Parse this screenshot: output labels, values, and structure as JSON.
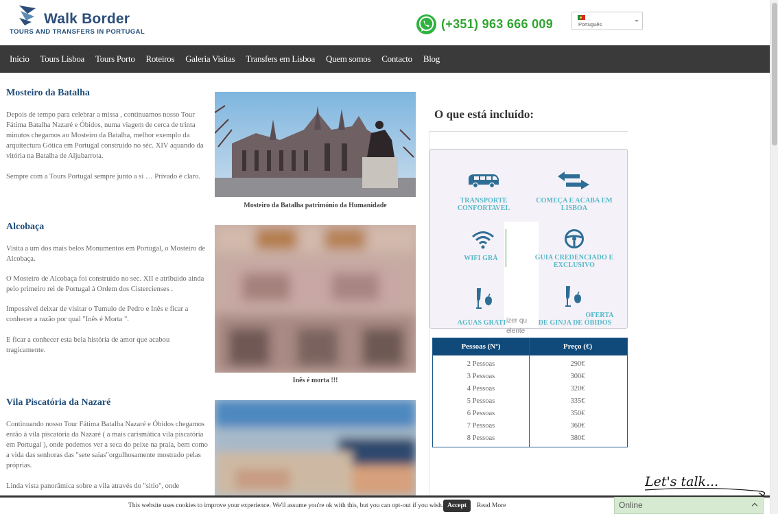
{
  "header": {
    "logo_title": "Walk Border",
    "logo_subtitle": "TOURS AND TRANSFERS IN PORTUGAL",
    "phone": "(+351) 963 666 009",
    "language": "Português",
    "brand_color": "#1f4d7a",
    "phone_color": "#2fa52f"
  },
  "nav": {
    "items": [
      "Início",
      "Tours Lisboa",
      "Tours Porto",
      "Roteiros",
      "Galeria Visitas",
      "Transfers em Lisboa",
      "Quem somos",
      "Contacto",
      "Blog"
    ]
  },
  "sections": [
    {
      "title": "Mosteiro da Batalha",
      "paragraphs": [
        "Depois de tempo para celebrar a missa , continuamos nosso Tour Fátima Batalha Nazaré e Óbidos, numa viagem de cerca de trinta minutos chegamos ao Mosteiro da Batalha, melhor exemplo da arquitectura Gótica em Portugal construido no séc. XIV aquando da vitória na Batalha de Aljubarrota.",
        "Sempre com a Tours Portugal sempre junto a si … Privado é claro."
      ],
      "caption": "Mosteiro da Batalha património da Humanidade"
    },
    {
      "title": "Alcobaça",
      "paragraphs": [
        "Visita a um dos mais belos Monumentos em Portugal, o Mosteiro de Alcobaça.",
        "O Mosteiro de Alcobaça foi construido no sec. XII e atribuido ainda pelo primeiro rei de Portugal à Ordem dos Cistercienses .",
        "Impossível deixar de visitar o Tumulo de Pedro e Inês e ficar a conhecer a razão por qual \"Inês é Morta \".",
        "E ficar a conhecer esta bela história de amor que acabou tragicamente."
      ],
      "caption": "Inês é morta !!!"
    },
    {
      "title": "Vila Piscatória da Nazaré",
      "paragraphs": [
        "Continuando nosso Tour Fátima Batalha Nazaré e Óbidos chegamos então á vila piscatória da Nazaré ( a mais carismática vila piscatória em Portugal ), onde podemos ver a seca do peixe na praia, bem como a vida das senhoras das \"sete saias\"orgulhosamente mostrado pelas próprias.",
        "Linda vista panorâmica sobre a vila através do \"sitio\", onde"
      ]
    }
  ],
  "included": {
    "title": "O que está incluído:",
    "features": [
      {
        "icon": "van-icon",
        "label_lines": [
          "TRANSPORTE",
          "CONFORTAVEL"
        ]
      },
      {
        "icon": "arrows-icon",
        "label_lines": [
          "COMEÇA E ACABA EM",
          "LISBOA"
        ]
      },
      {
        "icon": "wifi-icon",
        "label_lines": [
          "WIFI GRÁ"
        ]
      },
      {
        "icon": "steering-wheel-icon",
        "label_lines": [
          "GUIA CREDENCIADO E",
          "EXCLUSIVO"
        ]
      },
      {
        "icon": "drink-icon",
        "label_lines": [
          "AGUAS GRATI"
        ]
      },
      {
        "icon": "drink-icon",
        "label_lines": [
          "OFERTA",
          "DE GINJA DE ÓBIDOS"
        ]
      }
    ],
    "behind_text": [
      "izer qu",
      "elente"
    ],
    "accent_color": "#55b8c8"
  },
  "price_table": {
    "headers": [
      "Pessoas (Nº)",
      "Preço (€)"
    ],
    "rows": [
      [
        "2 Pessoas",
        "290€"
      ],
      [
        "3 Pessoas",
        "300€"
      ],
      [
        "4 Pessoas",
        "320€"
      ],
      [
        "5 Pessoas",
        "335€"
      ],
      [
        "6 Pessoas",
        "350€"
      ],
      [
        "7 Pessoas",
        "360€"
      ],
      [
        "8 Pessoas",
        "380€"
      ]
    ],
    "header_color": "#0f4a7a"
  },
  "cookie": {
    "text": "This website uses cookies to improve your experience. We'll assume you're ok with this, but you can opt-out if you wish.",
    "accept": "Accept",
    "read_more": "Read More"
  },
  "chat": {
    "prompt": "Let's talk...",
    "status": "Online"
  }
}
